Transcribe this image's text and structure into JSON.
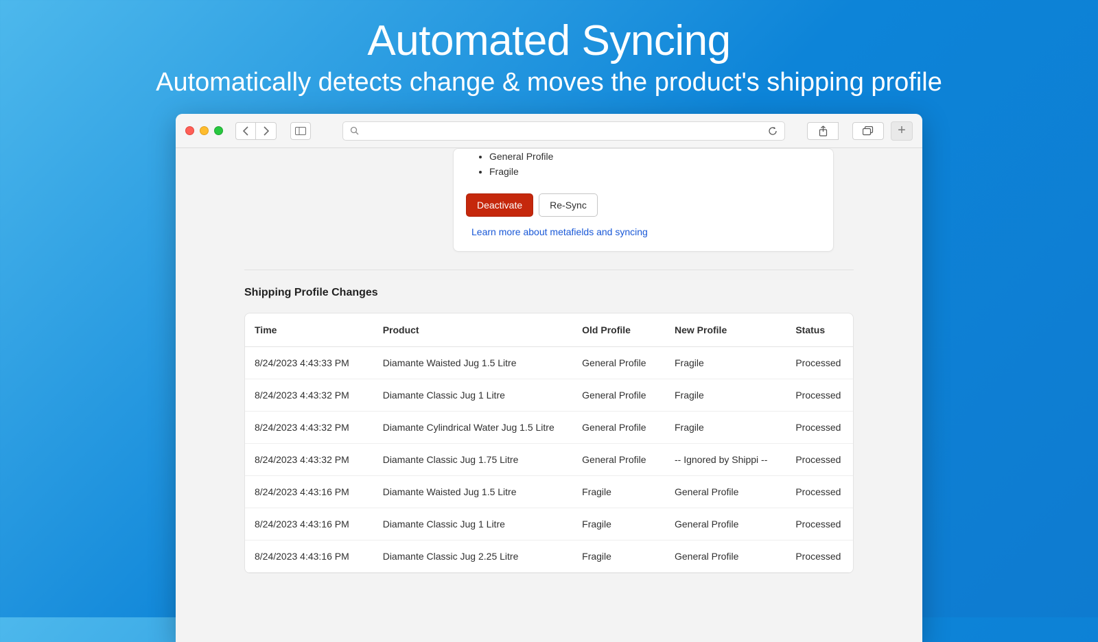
{
  "hero": {
    "title": "Automated Syncing",
    "subtitle": "Automatically detects change & moves the product's shipping profile"
  },
  "card": {
    "bullets": [
      "General Profile",
      "Fragile"
    ],
    "deactivate": "Deactivate",
    "resync": "Re-Sync",
    "learn_more": "Learn more about metafields and syncing"
  },
  "section_title": "Shipping Profile Changes",
  "table": {
    "headers": {
      "time": "Time",
      "product": "Product",
      "old": "Old Profile",
      "new": "New Profile",
      "status": "Status"
    },
    "rows": [
      {
        "time": "8/24/2023 4:43:33 PM",
        "product": "Diamante Waisted Jug 1.5 Litre",
        "old": "General Profile",
        "new": "Fragile",
        "status": "Processed"
      },
      {
        "time": "8/24/2023 4:43:32 PM",
        "product": "Diamante Classic Jug 1 Litre",
        "old": "General Profile",
        "new": "Fragile",
        "status": "Processed"
      },
      {
        "time": "8/24/2023 4:43:32 PM",
        "product": "Diamante Cylindrical Water Jug 1.5 Litre",
        "old": "General Profile",
        "new": "Fragile",
        "status": "Processed"
      },
      {
        "time": "8/24/2023 4:43:32 PM",
        "product": "Diamante Classic Jug 1.75 Litre",
        "old": "General Profile",
        "new": "-- Ignored by Shippi --",
        "status": "Processed"
      },
      {
        "time": "8/24/2023 4:43:16 PM",
        "product": "Diamante Waisted Jug 1.5 Litre",
        "old": "Fragile",
        "new": "General Profile",
        "status": "Processed"
      },
      {
        "time": "8/24/2023 4:43:16 PM",
        "product": "Diamante Classic Jug 1 Litre",
        "old": "Fragile",
        "new": "General Profile",
        "status": "Processed"
      },
      {
        "time": "8/24/2023 4:43:16 PM",
        "product": "Diamante Classic Jug 2.25 Litre",
        "old": "Fragile",
        "new": "General Profile",
        "status": "Processed"
      }
    ]
  }
}
